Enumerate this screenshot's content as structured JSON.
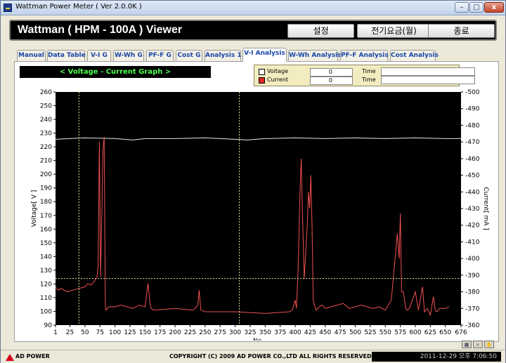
{
  "window": {
    "title": "Wattman Power Meter ( Ver 2.0.0K )",
    "min_glyph": "–",
    "max_glyph": "□",
    "close_glyph": "x"
  },
  "header": {
    "app_title": "Wattman ( HPM - 100A ) Viewer",
    "settings_label": "설정",
    "rate_label": "전기요금(월)",
    "exit_label": "종료"
  },
  "tabs": [
    {
      "label": "Manual"
    },
    {
      "label": "Data Table"
    },
    {
      "label": "V-I G"
    },
    {
      "label": "W-Wh G"
    },
    {
      "label": "PF-F G"
    },
    {
      "label": "Cost G"
    },
    {
      "label": "Analysis 1"
    },
    {
      "label": "V-I Analysis",
      "active": true
    },
    {
      "label": "W-Wh Analysis"
    },
    {
      "label": "PF-F Analysis"
    },
    {
      "label": "Cost Analysis"
    }
  ],
  "graph_title": "< Voltage - Current Graph >",
  "legend": {
    "voltage_label": "Voltage",
    "voltage_value": "0",
    "current_label": "Current",
    "current_value": "0",
    "time_label": "Time",
    "voltage_time": "",
    "current_time": ""
  },
  "colors": {
    "voltage_line": "#e6e6e6",
    "current_line": "#f05050",
    "cursor": "#e8e0a0",
    "plot_bg": "#000000",
    "axis_text": "#000000"
  },
  "chart_data": {
    "type": "line",
    "title": "< Voltage - Current Graph >",
    "xlabel": "No.",
    "ylabel": "Voltage[ V ]",
    "y2label": "Current[ mA ]",
    "xlim": [
      1,
      676
    ],
    "ylim": [
      90,
      260
    ],
    "y2lim": [
      360,
      500
    ],
    "x_ticks": [
      "1",
      "25",
      "50",
      "75",
      "100",
      "125",
      "150",
      "175",
      "200",
      "225",
      "250",
      "275",
      "300",
      "325",
      "350",
      "375",
      "400",
      "425",
      "450",
      "475",
      "500",
      "525",
      "550",
      "575",
      "600",
      "625",
      "650",
      "676"
    ],
    "x_tick_values": [
      1,
      25,
      50,
      75,
      100,
      125,
      150,
      175,
      200,
      225,
      250,
      275,
      300,
      325,
      350,
      375,
      400,
      425,
      450,
      475,
      500,
      525,
      550,
      575,
      600,
      625,
      650,
      676
    ],
    "y_ticks": [
      90,
      100,
      110,
      120,
      130,
      140,
      150,
      160,
      170,
      180,
      190,
      200,
      210,
      220,
      230,
      240,
      250,
      260
    ],
    "y2_ticks": [
      360,
      370,
      380,
      390,
      400,
      410,
      420,
      430,
      440,
      450,
      460,
      470,
      480,
      490,
      500
    ],
    "cursor_x": 40,
    "cursor_x2": 307,
    "cursor_y": 124,
    "series": [
      {
        "name": "Voltage",
        "axis": "left",
        "x": [
          1,
          50,
          100,
          130,
          150,
          200,
          250,
          300,
          320,
          350,
          400,
          450,
          500,
          550,
          600,
          650,
          676
        ],
        "values": [
          225.5,
          226.5,
          226,
          225,
          226,
          226,
          226.5,
          225.5,
          225,
          226,
          226.5,
          226,
          226.5,
          226,
          226.5,
          226,
          226
        ]
      },
      {
        "name": "Current",
        "axis": "right",
        "x": [
          1,
          5,
          10,
          20,
          30,
          40,
          50,
          55,
          60,
          65,
          70,
          72,
          74,
          76,
          78,
          80,
          82,
          84,
          85,
          87,
          90,
          100,
          110,
          120,
          130,
          140,
          150,
          155,
          158,
          160,
          165,
          200,
          230,
          238,
          240,
          243,
          250,
          300,
          350,
          390,
          395,
          400,
          402,
          405,
          408,
          410,
          412,
          415,
          420,
          422,
          424,
          426,
          428,
          430,
          432,
          435,
          440,
          445,
          450,
          460,
          470,
          480,
          490,
          500,
          510,
          520,
          530,
          540,
          550,
          560,
          565,
          570,
          573,
          575,
          577,
          580,
          582,
          584,
          586,
          590,
          600,
          605,
          608,
          612,
          615,
          620,
          625,
          630,
          633,
          636,
          640,
          650,
          656
        ],
        "values": [
          383,
          381,
          382,
          380,
          381,
          382,
          383,
          385,
          384,
          386,
          389,
          396,
          470,
          389,
          425,
          465,
          473,
          372,
          369,
          370,
          371,
          371,
          372,
          371,
          370,
          372,
          371,
          385,
          374,
          370,
          369,
          370,
          369,
          372,
          381,
          369,
          368,
          368,
          367,
          368,
          369,
          375,
          370,
          395,
          440,
          460,
          428,
          388,
          420,
          440,
          430,
          450,
          420,
          375,
          372,
          369,
          371,
          372,
          370,
          371,
          372,
          373,
          370,
          371,
          372,
          371,
          370,
          371,
          369,
          375,
          395,
          415,
          400,
          427,
          380,
          380,
          375,
          370,
          369,
          370,
          380,
          369,
          375,
          383,
          368,
          370,
          366,
          377,
          369,
          368,
          370,
          370,
          371
        ]
      }
    ]
  },
  "status": {
    "company": "AD POWER",
    "copyright": "COPYRIGHT (C) 2009 AD POWER CO.,LTD ALL RIGHTS RESERVED.",
    "datetime": "2011-12-29 오후 7:06:50"
  },
  "tools": [
    {
      "icon": "grid-icon",
      "glyph": "▦"
    },
    {
      "icon": "zoom-icon",
      "glyph": "⌕"
    },
    {
      "icon": "pan-hand-icon",
      "glyph": "✋"
    }
  ]
}
